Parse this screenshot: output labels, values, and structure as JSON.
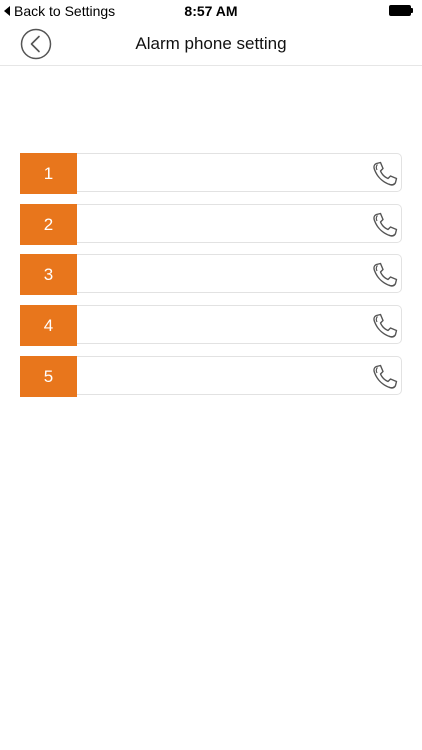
{
  "status_bar": {
    "back_label": "Back to Settings",
    "time": "8:57 AM"
  },
  "nav": {
    "title": "Alarm phone setting",
    "back_icon": "chevron-left-circle-icon"
  },
  "phone_slots": [
    {
      "number": "1",
      "value": "",
      "icon": "phone-handset-icon"
    },
    {
      "number": "2",
      "value": "",
      "icon": "phone-handset-icon"
    },
    {
      "number": "3",
      "value": "",
      "icon": "phone-handset-icon"
    },
    {
      "number": "4",
      "value": "",
      "icon": "phone-handset-icon"
    },
    {
      "number": "5",
      "value": "",
      "icon": "phone-handset-icon"
    }
  ],
  "colors": {
    "accent": "#e8761c",
    "row_border": "#e2e2e2",
    "background": "#ffffff"
  }
}
